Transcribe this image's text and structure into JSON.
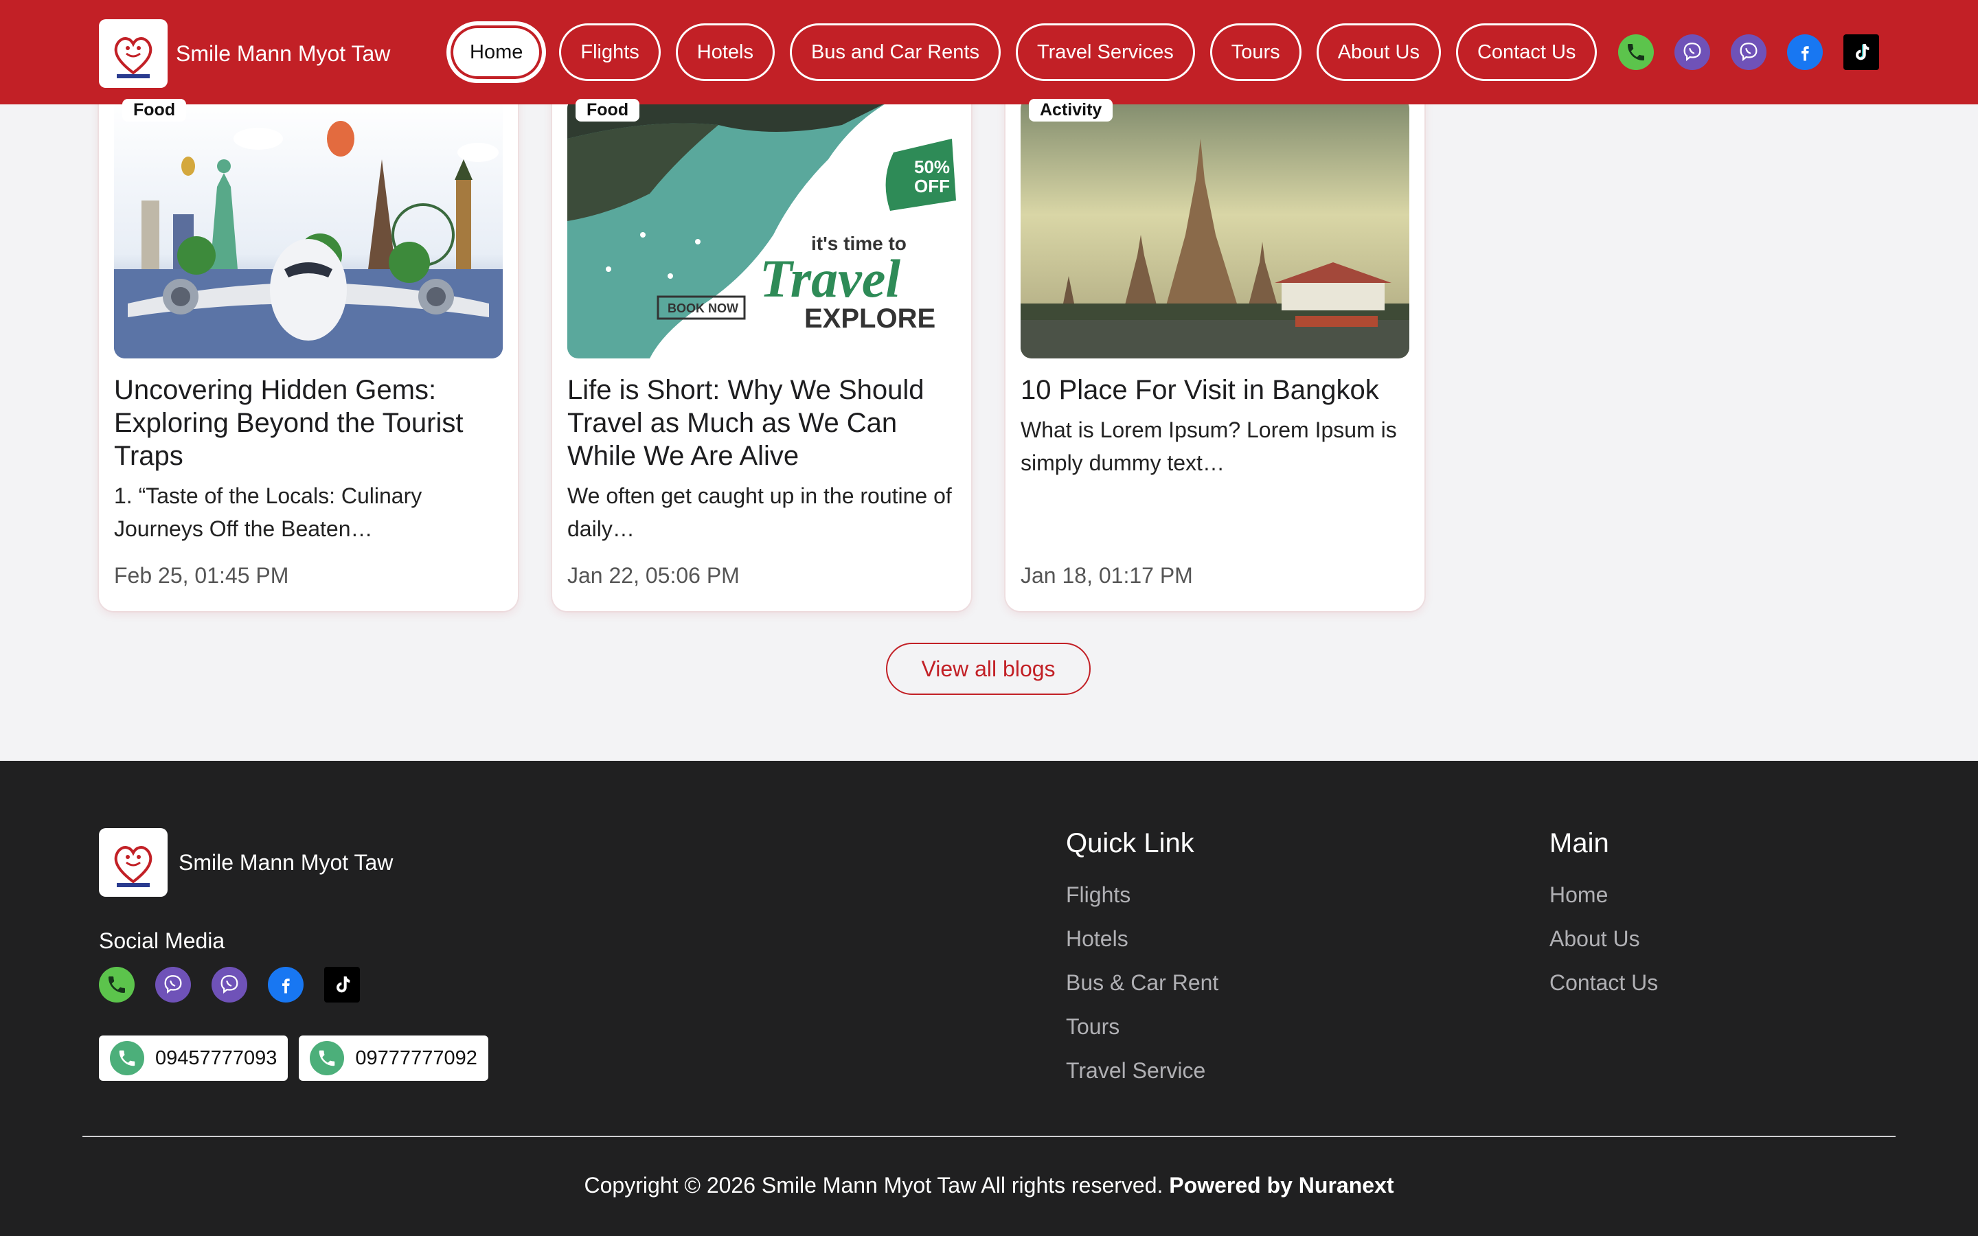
{
  "colors": {
    "brand_red": "#c22026",
    "footer_bg": "#202021",
    "page_bg": "#f3f3f5",
    "phone_green": "#5cc44c",
    "viber_purple": "#6f52b8",
    "facebook_blue": "#1877f2",
    "tiktok_black": "#000000"
  },
  "header": {
    "brand_name": "Smile Mann Myot Taw",
    "nav": [
      {
        "label": "Home",
        "active": true
      },
      {
        "label": "Flights"
      },
      {
        "label": "Hotels"
      },
      {
        "label": "Bus and Car Rents"
      },
      {
        "label": "Travel Services"
      },
      {
        "label": "Tours"
      },
      {
        "label": "About Us"
      },
      {
        "label": "Contact Us"
      }
    ],
    "social_icons": [
      "phone-icon",
      "viber-icon",
      "viber-icon",
      "facebook-icon",
      "tiktok-icon"
    ]
  },
  "blogs": [
    {
      "tag": "Food",
      "title": "Uncovering Hidden Gems: Exploring Beyond the Tourist Traps",
      "excerpt": "1. “Taste of the Locals: Culinary Journeys Off the Beaten…",
      "date": "Feb 25, 01:45 PM"
    },
    {
      "tag": "Food",
      "title": "Life is Short: Why We Should Travel as Much as We Can While We Are Alive",
      "excerpt": "We often get caught up in the routine of daily…",
      "date": "Jan 22, 05:06 PM",
      "image_text": {
        "discount": "50%",
        "off": "OFF",
        "tagline": "it's time to",
        "headline": "Travel",
        "sub": "EXPLORE",
        "cta": "BOOK NOW"
      }
    },
    {
      "tag": "Activity",
      "title": "10 Place For Visit in Bangkok",
      "excerpt": "What is Lorem Ipsum? Lorem Ipsum is simply dummy text…",
      "date": "Jan 18, 01:17 PM"
    }
  ],
  "view_all_label": "View all blogs",
  "footer": {
    "brand_name": "Smile Mann Myot Taw",
    "social_title": "Social Media",
    "phones": [
      "09457777093",
      "09777777092"
    ],
    "quick_link": {
      "title": "Quick Link",
      "links": [
        "Flights",
        "Hotels",
        "Bus & Car Rent",
        "Tours",
        "Travel Service"
      ]
    },
    "main": {
      "title": "Main",
      "links": [
        "Home",
        "About Us",
        "Contact Us"
      ]
    },
    "copyright": "Copyright © 2026 Smile Mann Myot Taw All rights reserved.",
    "powered_by": "Powered by Nuranext"
  }
}
